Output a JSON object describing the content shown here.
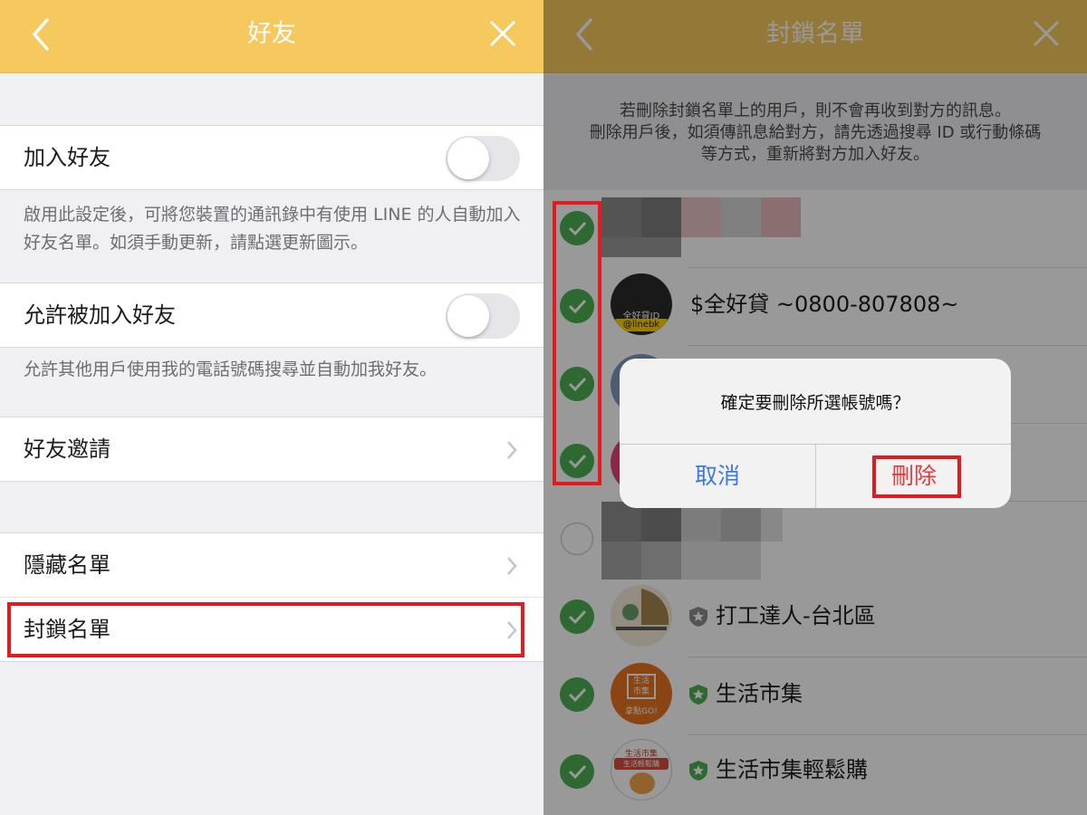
{
  "colors": {
    "header_bg": "#f5c95d",
    "check_green": "#4caf50",
    "highlight_red": "#e01b22",
    "cancel_blue": "#3a7ae0",
    "delete_red": "#e23b3b"
  },
  "left": {
    "title": "好友",
    "back_icon": "chevron-left-icon",
    "close_icon": "close-icon",
    "add_friends": {
      "label": "加入好友",
      "enabled": false,
      "description": "啟用此設定後，可將您裝置的通訊錄中有使用 LINE 的人自動加入好友名單。如須手動更新，請點選更新圖示。"
    },
    "allow_added": {
      "label": "允許被加入好友",
      "enabled": false,
      "description": "允許其他用戶使用我的電話號碼搜尋並自動加我好友。"
    },
    "friend_invite": {
      "label": "好友邀請"
    },
    "hidden_list": {
      "label": "隱藏名單"
    },
    "blocked_list": {
      "label": "封鎖名單"
    }
  },
  "right": {
    "title": "封鎖名單",
    "notice_line1": "若刪除封鎖名單上的用戶，則不會再收到對方的訊息。",
    "notice_line2": "刪除用戶後，如須傳訊息給對方，請先透過搜尋 ID 或行動條碼",
    "notice_line3": "等方式，重新將對方加入好友。",
    "contacts": [
      {
        "name": "",
        "checked": true,
        "blurred": true
      },
      {
        "name": "$全好貸 ~0800-807808~",
        "checked": true,
        "avatar_text_1": "全好貸ID",
        "avatar_text_2": "@linebk"
      },
      {
        "name": "",
        "checked": true
      },
      {
        "name": "",
        "checked": true
      },
      {
        "name": "",
        "checked": false,
        "blurred": true
      },
      {
        "name": "打工達人-台北區",
        "checked": true,
        "badge": "gray"
      },
      {
        "name": "生活市集",
        "checked": true,
        "badge": "green",
        "avatar_text_1": "生活",
        "avatar_text_2": "市集",
        "avatar_text_3": "拿點GO!"
      },
      {
        "name": "生活市集輕鬆購",
        "checked": true,
        "badge": "green",
        "avatar_text_1": "生活市集",
        "avatar_text_2": "生活輕鬆購"
      }
    ],
    "dialog": {
      "message": "確定要刪除所選帳號嗎？",
      "cancel_label": "取消",
      "delete_label": "刪除"
    }
  }
}
